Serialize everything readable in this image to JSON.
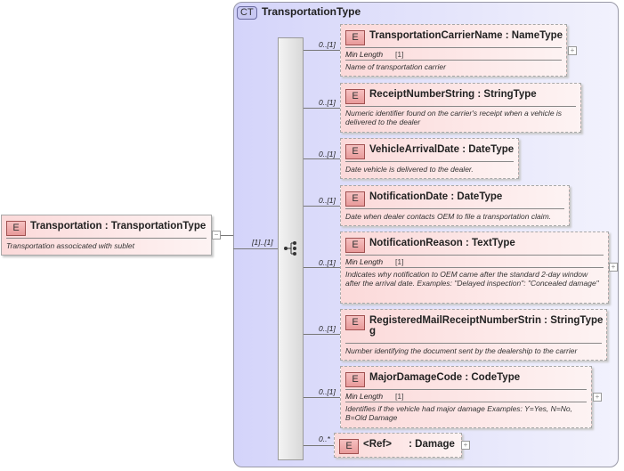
{
  "root": {
    "badge": "E",
    "name": "Transportation",
    "type": "TransportationType",
    "doc": "Transportation associcated with sublet",
    "cardinality": "[1]..[1]",
    "toggle": "−"
  },
  "complex_type": {
    "badge": "CT",
    "name": "TransportationType"
  },
  "min_length_label": "Min Length",
  "elements": [
    {
      "badge": "E",
      "title": "TransportationCarrierName : NameType",
      "min_length": "[1]",
      "doc": "Name of transportation carrier",
      "cardinality": "0..[1]",
      "toggle": "+"
    },
    {
      "badge": "E",
      "title": "ReceiptNumberString : StringType",
      "doc": "Numeric identifier found on the carrier's receipt when a vehicle is delivered to the dealer",
      "cardinality": "0..[1]"
    },
    {
      "badge": "E",
      "title": "VehicleArrivalDate : DateType",
      "doc": "Date vehicle is delivered to the dealer.",
      "cardinality": "0..[1]"
    },
    {
      "badge": "E",
      "title": "NotificationDate : DateType",
      "doc": "Date when dealer contacts OEM to file a transportation claim.",
      "cardinality": "0..[1]"
    },
    {
      "badge": "E",
      "title": "NotificationReason : TextType",
      "min_length": "[1]",
      "doc": "Indicates why notification to OEM came after the standard 2-day window after the arrival date. Examples: \"Delayed inspection\": \"Concealed damage\"",
      "cardinality": "0..[1]",
      "toggle": "+"
    },
    {
      "badge": "E",
      "title": "RegisteredMailReceiptNumberStrin : StringType",
      "title2": "g",
      "doc": "Number identifying the document sent by the dealership to the carrier",
      "cardinality": "0..[1]"
    },
    {
      "badge": "E",
      "title": "MajorDamageCode : CodeType",
      "min_length": "[1]",
      "doc": "Identifies if the vehicle had major damage Examples: Y=Yes, N=No, B=Old Damage",
      "cardinality": "0..[1]",
      "toggle": "+"
    },
    {
      "badge": "E",
      "title": "<Ref>      : Damage",
      "cardinality": "0..*",
      "toggle": "+"
    }
  ]
}
